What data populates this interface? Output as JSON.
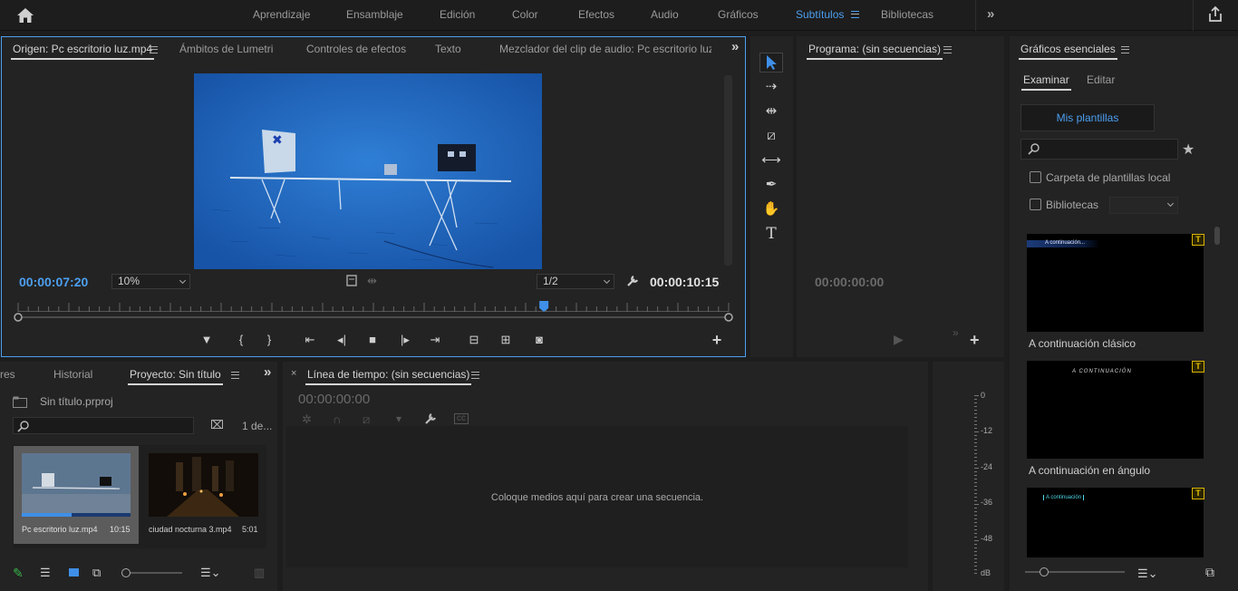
{
  "workspaces": [
    "Aprendizaje",
    "Ensamblaje",
    "Edición",
    "Color",
    "Efectos",
    "Audio",
    "Gráficos",
    "Subtítulos",
    "Bibliotecas"
  ],
  "active_workspace": "Subtítulos",
  "source_panel": {
    "tabs": [
      "Origen: Pc escritorio luz.mp4",
      "Ámbitos de Lumetri",
      "Controles de efectos",
      "Texto",
      "Mezclador del clip de audio: Pc escritorio luz.mp"
    ],
    "current_time": "00:00:07:20",
    "zoom": "10%",
    "resolution": "1/2",
    "duration": "00:00:10:15",
    "playhead_fraction": 0.74
  },
  "program_panel": {
    "title": "Programa: (sin secuencias)",
    "time": "00:00:00:00"
  },
  "essential_graphics": {
    "title": "Gráficos esenciales",
    "tabs": [
      "Examinar",
      "Editar"
    ],
    "my_templates_button": "Mis plantillas",
    "checkbox_local": "Carpeta de plantillas local",
    "checkbox_libraries": "Bibliotecas",
    "templates": [
      {
        "name": "A continuación clásico",
        "overlay": "A continuación..."
      },
      {
        "name": "A continuación en ángulo",
        "overlay": "A CONTINUACIÓN"
      },
      {
        "name": "",
        "overlay": "A continuación"
      }
    ],
    "badge": "T"
  },
  "project_panel": {
    "tabs": [
      "res",
      "Historial",
      "Proyecto: Sin título"
    ],
    "project_file": "Sin título.prproj",
    "count": "1 de...",
    "clips": [
      {
        "name": "Pc escritorio luz.mp4",
        "duration": "10:15"
      },
      {
        "name": "ciudad nocturna 3.mp4",
        "duration": "5:01"
      }
    ]
  },
  "timeline": {
    "title": "Línea de tiempo: (sin secuencias)",
    "time": "00:00:00:00",
    "placeholder": "Coloque medios aquí para crear una secuencia."
  },
  "audio_meter": {
    "labels": [
      "0",
      "-12",
      "-24",
      "-36",
      "-48",
      "dB"
    ]
  },
  "colors": {
    "accent": "#4c9ff0",
    "panel": "#232323",
    "background": "#1d1d1d"
  }
}
